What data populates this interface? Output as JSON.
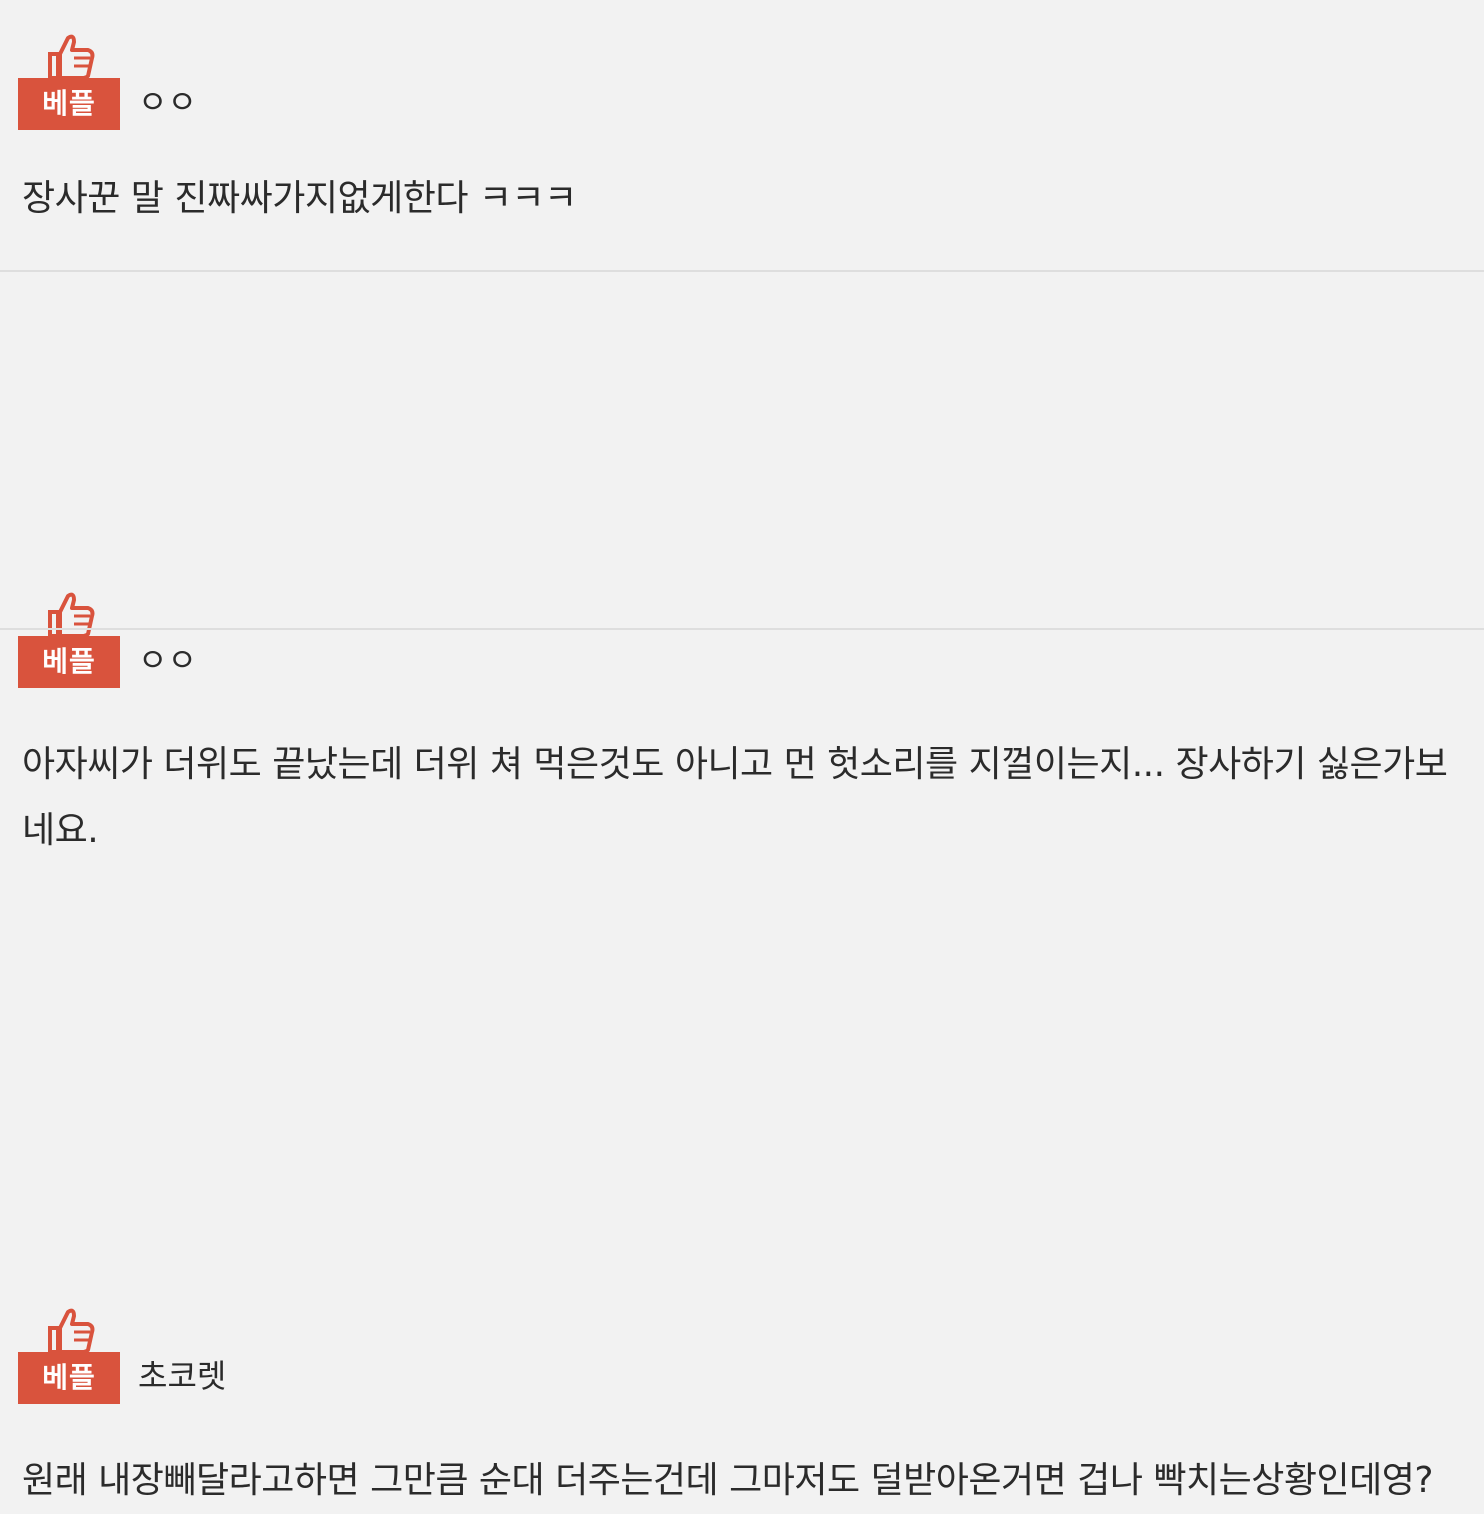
{
  "comments": [
    {
      "badge": "베플",
      "username": "ㅇㅇ",
      "text": "장사꾼 말 진짜싸가지없게한다 ㅋㅋㅋ"
    },
    {
      "badge": "베플",
      "username": "ㅇㅇ",
      "text": "아자씨가 더위도 끝났는데 더위 쳐 먹은것도 아니고 먼 헛소리를 지껄이는지... 장사하기 싫은가보네요."
    },
    {
      "badge": "베플",
      "username": "초코렛",
      "text": "원래 내장빼달라고하면 그만큼 순대 더주는건데 그마저도 덜받아온거면 겁나 빡치는상황인데영?"
    }
  ],
  "colors": {
    "badge": "#d9533d",
    "background": "#f2f2f2",
    "divider": "#dedede",
    "text": "#2b2b2b"
  },
  "icons": {
    "badge_icon": "thumbs-up-icon"
  }
}
